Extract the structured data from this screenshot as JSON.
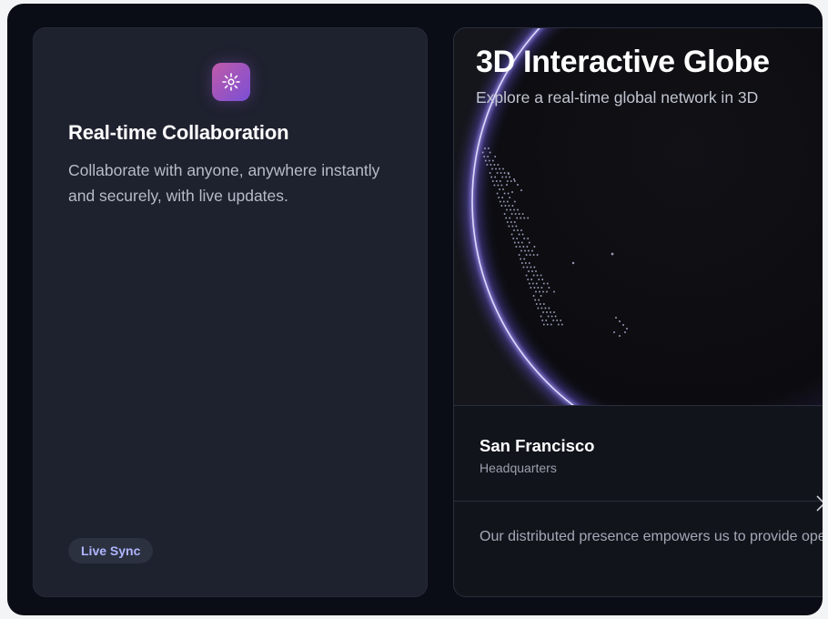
{
  "collab_card": {
    "icon": "sun-burst-icon",
    "title": "Real-time Collaboration",
    "description": "Collaborate with anyone, anywhere instantly and securely, with live updates.",
    "tag": "Live Sync"
  },
  "globe_card": {
    "title": "3D Interactive Globe",
    "subtitle": "Explore a real-time global network in 3D",
    "location": {
      "name": "San Francisco",
      "label": "Headquarters"
    },
    "description": "Our distributed presence empowers us to provide operate."
  },
  "colors": {
    "frame_bg": "#0a0d16",
    "card_bg": "#1e212e",
    "accent_purple": "#8b7cf6",
    "tag_text": "#aeb6ff"
  }
}
